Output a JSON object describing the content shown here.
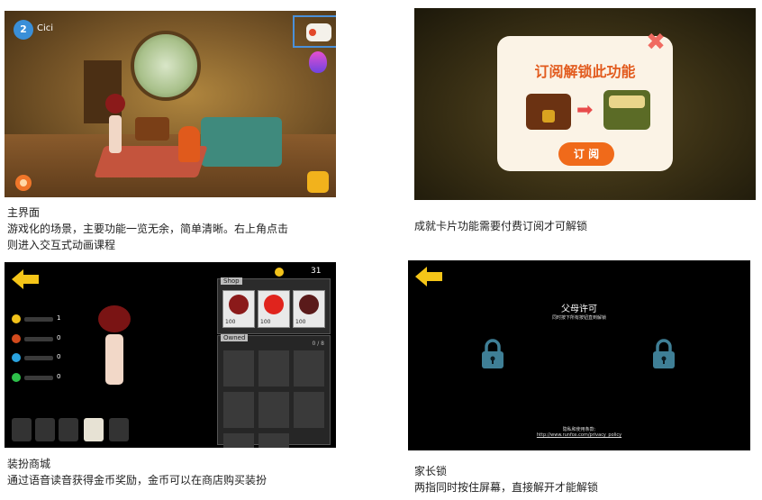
{
  "panel1": {
    "level": "2",
    "username": "Cici",
    "caption_title": "主界面",
    "caption_line1": "游戏化的场景，主要功能一览无余，简单清晰。右上角点击",
    "caption_line2": "则进入交互式动画课程"
  },
  "panel2": {
    "dialog_title": "订阅解锁此功能",
    "subscribe_label": "订 阅",
    "close_glyph": "✖",
    "arrow_glyph": "➡",
    "caption": "成就卡片功能需要付费订阅才可解锁"
  },
  "panel3": {
    "coins": "31",
    "stats": [
      "1",
      "0",
      "0",
      "0"
    ],
    "shop_label": "Shop",
    "shop_prices": [
      "100",
      "100",
      "100"
    ],
    "owned_label": "Owned",
    "owned_count": "0 / 8",
    "caption_title": "装扮商城",
    "caption_line1": "通过语音读音获得金币奖励，金币可以在商店购买装扮"
  },
  "panel4": {
    "title": "父母许可",
    "subtitle": "同时按下所有按钮直到解锁",
    "policy_label": "隐私和使用条款:",
    "policy_link": "http://www.runfox.com/privacy_policy",
    "caption_title": "家长锁",
    "caption_line1": "两指同时按住屏幕，直接解开才能解锁"
  },
  "colors": {
    "accent_orange": "#f06a1a",
    "title_orange": "#e25b1e",
    "highlight_blue": "#4a90d9",
    "lock_teal": "#3f7f96",
    "arrow_yellow": "#f5c518"
  },
  "icons": [
    "level-badge-icon",
    "lesson-icon",
    "egg-icon",
    "gear-icon",
    "bag-icon",
    "close-icon",
    "arrow-right-icon",
    "back-arrow-icon",
    "coin-icon",
    "lock-icon"
  ]
}
